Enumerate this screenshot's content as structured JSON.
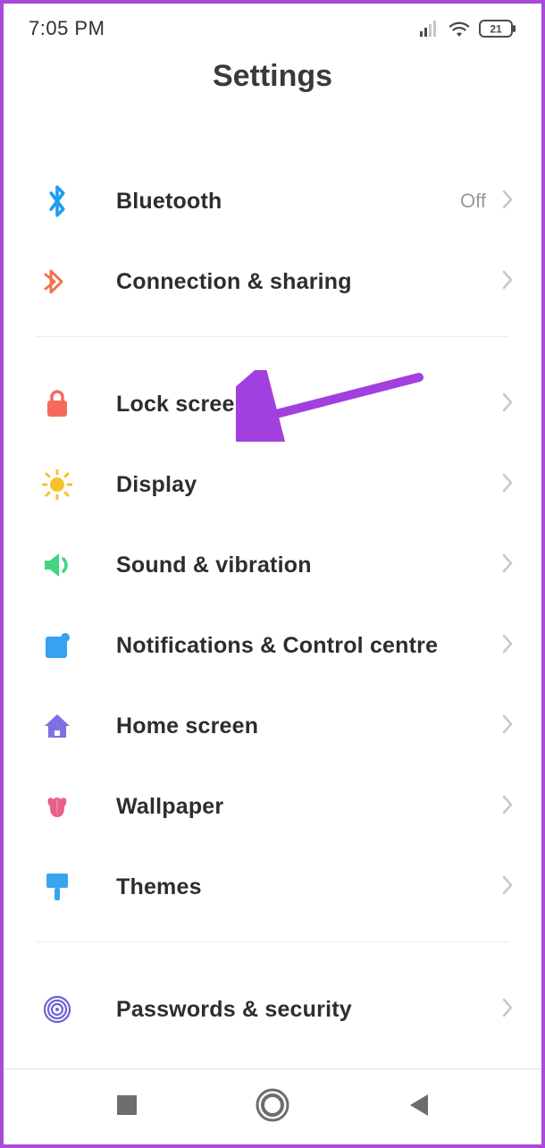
{
  "status_bar": {
    "time": "7:05 PM",
    "battery": "21"
  },
  "title": "Settings",
  "items": [
    {
      "id": "bluetooth",
      "label": "Bluetooth",
      "value": "Off",
      "icon": "bluetooth",
      "color": "#1e9df2"
    },
    {
      "id": "connection",
      "label": "Connection & sharing",
      "value": "",
      "icon": "share",
      "color": "#f3724c"
    },
    {
      "divider": true
    },
    {
      "id": "lockscreen",
      "label": "Lock screen",
      "value": "",
      "icon": "lock",
      "color": "#f46a5b"
    },
    {
      "id": "display",
      "label": "Display",
      "value": "",
      "icon": "sun",
      "color": "#f8c22e"
    },
    {
      "id": "sound",
      "label": "Sound & vibration",
      "value": "",
      "icon": "sound",
      "color": "#3fd583"
    },
    {
      "id": "notifications",
      "label": "Notifications & Control centre",
      "value": "",
      "icon": "notif",
      "color": "#37a2ef"
    },
    {
      "id": "home",
      "label": "Home screen",
      "value": "",
      "icon": "home",
      "color": "#7d70e4"
    },
    {
      "id": "wallpaper",
      "label": "Wallpaper",
      "value": "",
      "icon": "flower",
      "color": "#e86186"
    },
    {
      "id": "themes",
      "label": "Themes",
      "value": "",
      "icon": "brush",
      "color": "#38a4f0"
    },
    {
      "divider": true
    },
    {
      "id": "passwords",
      "label": "Passwords & security",
      "value": "",
      "icon": "fingerprint",
      "color": "#6d63d2"
    }
  ],
  "annotation": {
    "arrow_color": "#a23fdf"
  }
}
